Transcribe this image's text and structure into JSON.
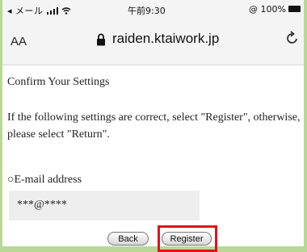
{
  "status_bar": {
    "carrier": "◂ メール ",
    "time": "午前9:30",
    "battery": "@ 100%"
  },
  "browser": {
    "text_size": "AA",
    "url": "raiden.ktaiwork.jp",
    "reload_icon": "reload-icon"
  },
  "page": {
    "heading": "Confirm Your Settings",
    "instruction": "If the following settings are correct, select \"Register\", otherwise, please select \"Return\".",
    "email_label": "○E-mail address",
    "email_value": "***@****",
    "back_label": "Back",
    "register_label": "Register"
  },
  "colors": {
    "highlight": "#e0121b",
    "frame": "#b8d896"
  }
}
